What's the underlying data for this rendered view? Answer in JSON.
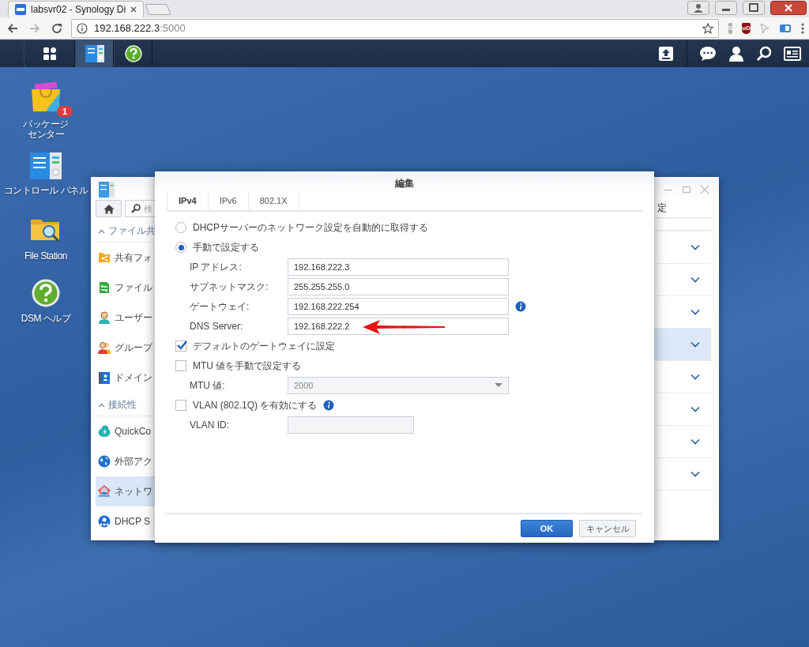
{
  "browser": {
    "tab": {
      "title": "labsvr02 - Synology Di"
    },
    "address": {
      "host": "192.168.222.3",
      "port": ":5000"
    },
    "extensions": [
      {
        "kind": "s",
        "label": "S"
      },
      {
        "kind": "ublock",
        "label": "uD"
      },
      {
        "kind": "cursor"
      },
      {
        "kind": "card"
      }
    ]
  },
  "desktop_icons": [
    {
      "kind": "package",
      "label": "パッケージセンター",
      "badge": "1"
    },
    {
      "kind": "controlpanel",
      "label": "コントロール パネル"
    },
    {
      "kind": "filestation",
      "label": "File Station"
    },
    {
      "kind": "help",
      "label": "DSM ヘルプ"
    }
  ],
  "control_panel": {
    "search_placeholder": "検",
    "toolbar_text": "定",
    "sidebar": [
      {
        "kind": "section",
        "label": "ファイル共"
      },
      {
        "kind": "sharedfolder",
        "label": "共有フォ",
        "selected": false
      },
      {
        "kind": "fileservices",
        "label": "ファイル",
        "selected": false
      },
      {
        "kind": "user",
        "label": "ユーザー",
        "selected": false
      },
      {
        "kind": "group",
        "label": "グループ",
        "selected": false
      },
      {
        "kind": "domain",
        "label": "ドメイン",
        "selected": false
      },
      {
        "kind": "section",
        "label": "接続性"
      },
      {
        "kind": "quickconnect",
        "label": "QuickCo",
        "selected": false
      },
      {
        "kind": "externalaccess",
        "label": "外部アク",
        "selected": false
      },
      {
        "kind": "network",
        "label": "ネットワ",
        "selected": true
      },
      {
        "kind": "dhcp",
        "label": "DHCP S",
        "selected": false
      }
    ],
    "rows": [
      {
        "selected": false
      },
      {
        "selected": false
      },
      {
        "selected": false
      },
      {
        "selected": true
      },
      {
        "selected": false
      },
      {
        "selected": false
      },
      {
        "selected": false
      },
      {
        "selected": false
      }
    ]
  },
  "dialog": {
    "title": "編集",
    "tabs": [
      {
        "label": "IPv4",
        "selected": true
      },
      {
        "label": "IPv6",
        "selected": false
      },
      {
        "label": "802.1X",
        "selected": false
      }
    ],
    "options": [
      {
        "kind": "radio",
        "label": "DHCPサーバーのネットワーク設定を自動的に取得する",
        "selected": false
      },
      {
        "kind": "radio",
        "label": "手動で設定する",
        "selected": true
      },
      {
        "kind": "field",
        "label": "IP アドレス:",
        "value": "192.168.222.3"
      },
      {
        "kind": "field",
        "label": "サブネットマスク:",
        "value": "255.255.255.0"
      },
      {
        "kind": "field",
        "label": "ゲートウェイ:",
        "value": "192.168.222.254",
        "info": true
      },
      {
        "kind": "field",
        "label": "DNS Server:",
        "value": "192.168.222.2",
        "arrow": true
      },
      {
        "kind": "checkbox",
        "label": "デフォルトのゲートウェイに設定",
        "checked": true
      },
      {
        "kind": "checkbox",
        "label": "MTU 値を手動で設定する",
        "checked": false
      },
      {
        "kind": "select",
        "label": "MTU 値:",
        "value": "2000",
        "disabled": true
      },
      {
        "kind": "checkbox",
        "label": "VLAN (802.1Q) を有効にする",
        "checked": false,
        "info": true
      },
      {
        "kind": "smallfield",
        "label": "VLAN ID:",
        "disabled": true
      }
    ],
    "buttons": [
      {
        "kind": "primary",
        "label": "OK"
      },
      {
        "kind": "secondary",
        "label": "キャンセル"
      }
    ]
  }
}
